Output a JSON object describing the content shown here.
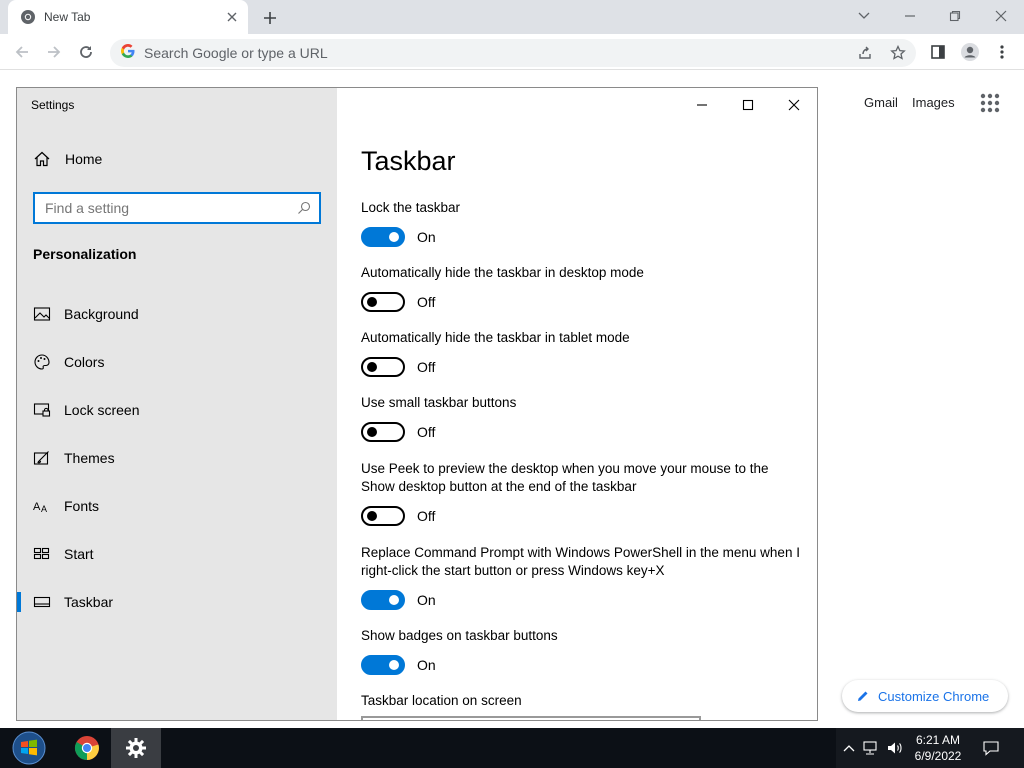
{
  "browser": {
    "tab": {
      "title": "New Tab"
    },
    "omnibox": {
      "placeholder": "Search Google or type a URL"
    },
    "ntp": {
      "gmail_label": "Gmail",
      "images_label": "Images",
      "customize_label": "Customize Chrome"
    }
  },
  "settings_window": {
    "title": "Settings",
    "home_label": "Home",
    "search_placeholder": "Find a setting",
    "section": "Personalization",
    "nav": [
      {
        "label": "Background",
        "icon": "image-icon"
      },
      {
        "label": "Colors",
        "icon": "palette-icon"
      },
      {
        "label": "Lock screen",
        "icon": "lock-screen-icon"
      },
      {
        "label": "Themes",
        "icon": "brush-icon"
      },
      {
        "label": "Fonts",
        "icon": "font-icon"
      },
      {
        "label": "Start",
        "icon": "start-icon"
      },
      {
        "label": "Taskbar",
        "icon": "taskbar-icon",
        "active": true
      }
    ],
    "page_title": "Taskbar",
    "settings": [
      {
        "label": "Lock the taskbar",
        "state": "On"
      },
      {
        "label": "Automatically hide the taskbar in desktop mode",
        "state": "Off"
      },
      {
        "label": "Automatically hide the taskbar in tablet mode",
        "state": "Off"
      },
      {
        "label": "Use small taskbar buttons",
        "state": "Off"
      },
      {
        "label": "Use Peek to preview the desktop when you move your mouse to the Show desktop button at the end of the taskbar",
        "state": "Off"
      },
      {
        "label": "Replace Command Prompt with Windows PowerShell in the menu when I right-click the start button or press Windows key+X",
        "state": "On"
      },
      {
        "label": "Show badges on taskbar buttons",
        "state": "On"
      },
      {
        "label": "Taskbar location on screen"
      }
    ]
  },
  "taskbar": {
    "clock_time": "6:21 AM",
    "clock_date": "6/9/2022"
  },
  "colors": {
    "accent": "#0078d7",
    "chrome_link": "#1a73e8"
  }
}
